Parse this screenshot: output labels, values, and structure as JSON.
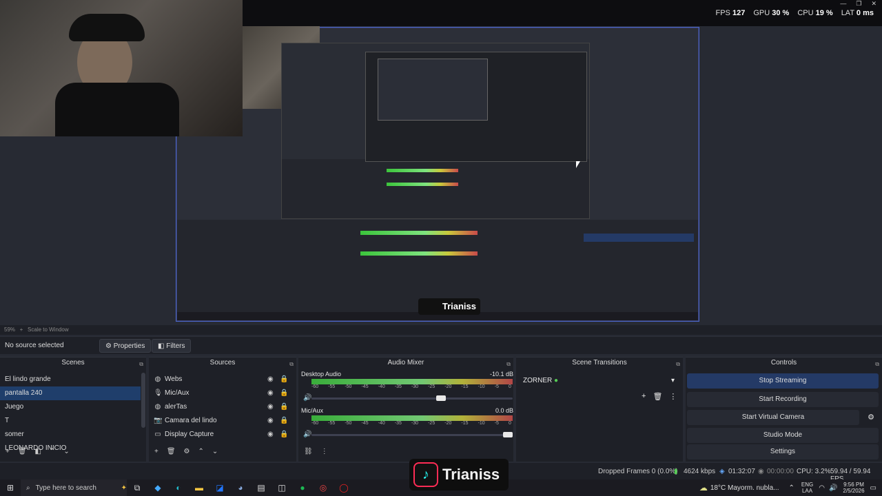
{
  "top_stats": {
    "fps_label": "FPS",
    "fps_value": "127",
    "gpu_label": "GPU",
    "gpu_value": "30 %",
    "cpu_label": "CPU",
    "cpu_value": "19 %",
    "lat_label": "LAT",
    "lat_value": "0 ms"
  },
  "window_controls": {
    "minimize": "—",
    "restore": "❐",
    "close": "✕"
  },
  "nested_overlay": {
    "tiktok_name": "Trianiss"
  },
  "toolbar": {
    "zoom": "59%",
    "scale_mode": "Scale to Window"
  },
  "context_bar": {
    "no_source": "No source selected",
    "properties": "Properties",
    "filters": "Filters"
  },
  "scenes": {
    "title": "Scenes",
    "items": [
      "El lindo grande",
      "pantalla 240",
      "Juego",
      "T",
      "somer",
      "LEONARDO INICIO"
    ],
    "selected": "pantalla 240"
  },
  "sources": {
    "title": "Sources",
    "items": [
      {
        "name": "Webs",
        "icon": "globe-icon"
      },
      {
        "name": "Mic/Aux",
        "icon": "mic-icon"
      },
      {
        "name": "alerTas",
        "icon": "globe-icon"
      },
      {
        "name": "Camara del lindo",
        "icon": "camera-icon"
      },
      {
        "name": "Display Capture",
        "icon": "monitor-icon"
      }
    ]
  },
  "audio_mixer": {
    "title": "Audio Mixer",
    "tracks": [
      {
        "name": "Desktop Audio",
        "db": "-10.1 dB",
        "volume": 0.65
      },
      {
        "name": "Mic/Aux",
        "db": "0.0 dB",
        "volume": 1.0
      }
    ],
    "scale": [
      "-60",
      "-55",
      "-50",
      "-45",
      "-40",
      "-35",
      "-30",
      "-25",
      "-20",
      "-15",
      "-10",
      "-5",
      "0"
    ]
  },
  "scene_transitions": {
    "title": "Scene Transitions",
    "selected": "ZORNER"
  },
  "controls": {
    "title": "Controls",
    "stop_streaming": "Stop Streaming",
    "start_recording": "Start Recording",
    "start_virtual_camera": "Start Virtual Camera",
    "studio_mode": "Studio Mode",
    "settings": "Settings"
  },
  "status": {
    "dropped_frames": "Dropped Frames 0 (0.0%)",
    "bitrate": "4624 kbps",
    "stream_time": "01:32:07",
    "rec_time": "00:00:00",
    "cpu": "CPU: 3.2%",
    "fps": "59.94 / 59.94 FPS"
  },
  "overlay": {
    "tiktok_name": "Trianiss"
  },
  "taskbar": {
    "search_placeholder": "Type here to search",
    "weather": "18°C  Mayorm. nubla...",
    "lang1": "ENG",
    "lang2": "LAA",
    "time": "9:56 PM",
    "date": "2/5/2026"
  }
}
